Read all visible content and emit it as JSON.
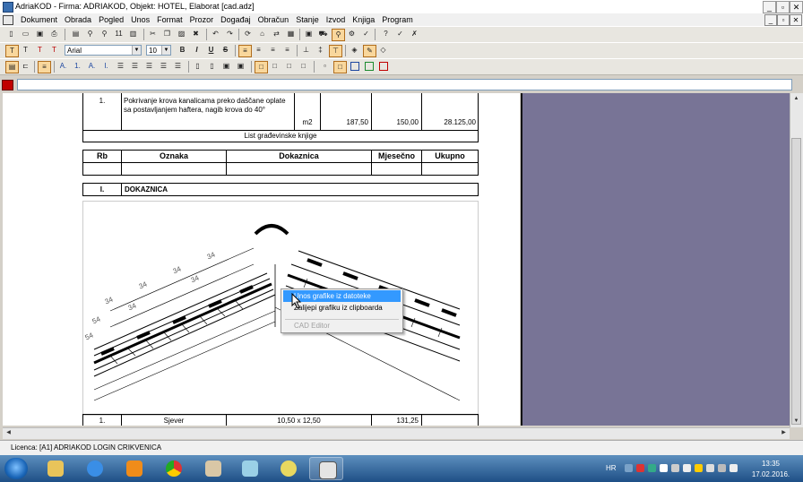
{
  "window": {
    "title": "AdriaKOD - Firma: ADRIAKOD,   Objekt: HOTEL, Elaborat [cad.adz]",
    "min": "_",
    "max": "▫",
    "close": "✕"
  },
  "menu": [
    "Dokument",
    "Obrada",
    "Pogled",
    "Unos",
    "Format",
    "Prozor",
    "Događaj",
    "Obračun",
    "Stanje",
    "Izvod",
    "Knjiga",
    "Program"
  ],
  "toolbar2": {
    "font": "Arial",
    "size": "10",
    "bold": "B",
    "italic": "I",
    "underline": "U",
    "strike": "S",
    "t_buttons": [
      "T",
      "T",
      "T",
      "T"
    ]
  },
  "toolbar3": {
    "list_labels": [
      "A.",
      "1.",
      "A.",
      "I."
    ]
  },
  "table1": {
    "rb": "1.",
    "desc": "Pokrivanje krova kanalicama preko daščane oplate sa postavljanjem haftera, nagib krova do 40°",
    "unit": "m2",
    "qty": "187,50",
    "price": "150,00",
    "total": "28.125,00"
  },
  "section_title": "List građevinske knjige",
  "headers": {
    "rb": "Rb",
    "oznaka": "Oznaka",
    "dokaznica": "Dokaznica",
    "mjesecno": "Mjesečno",
    "ukupno": "Ukupno"
  },
  "dokaznica": {
    "num": "I.",
    "label": "DOKAZNICA"
  },
  "drawing_dims": [
    "34",
    "34",
    "34",
    "34",
    "34",
    "34",
    "54",
    "54"
  ],
  "bottom_row": {
    "rb": "1.",
    "oznaka": "Sjever",
    "dokaznica": "10,50 x 12,50",
    "mjesecno": "131,25"
  },
  "context_menu": {
    "items": [
      {
        "label": "Unos grafike iz datoteke",
        "selected": true,
        "disabled": false
      },
      {
        "label": "Zalijepi grafiku iz clipboarda",
        "selected": false,
        "disabled": false
      },
      {
        "label": "CAD Editor",
        "selected": false,
        "disabled": true
      }
    ]
  },
  "status": {
    "text": "Licenca: [A1] ADRIAKOD LOGIN CRIKVENICA"
  },
  "taskbar": {
    "lang": "HR",
    "time": "13:35",
    "date": "17.02.2016."
  },
  "colors": {
    "accent_selected": "#3399ff",
    "right_pane": "#787496",
    "taskbar": "#1e4f86"
  }
}
